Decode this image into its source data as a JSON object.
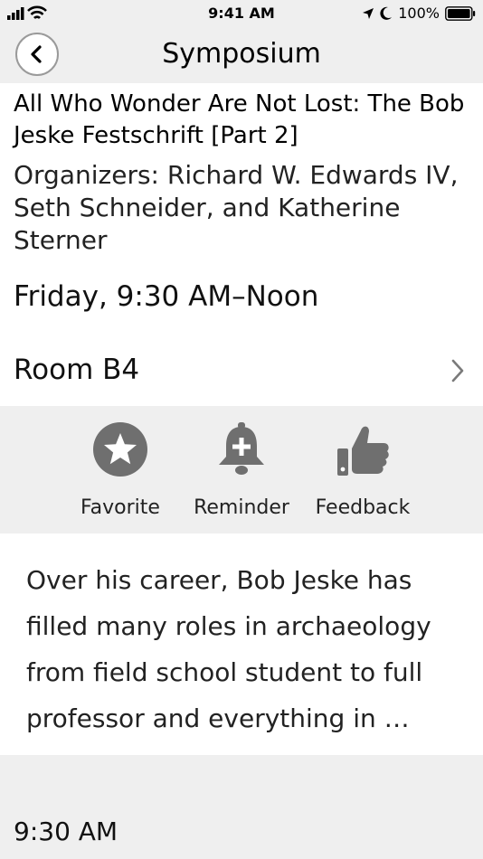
{
  "status_bar": {
    "time": "9:41 AM",
    "battery": "100%"
  },
  "nav": {
    "title": "Symposium",
    "back_icon": "chevron-left-icon"
  },
  "session": {
    "title": "All Who Wonder Are Not Lost: The Bob Jeske Festschrift [Part 2]",
    "organizers": "Organizers: Richard W. Edwards IV, Seth Schneider, and Katherine Sterner",
    "when": "Friday, 9:30 AM–Noon",
    "room": "Room B4"
  },
  "actions": [
    {
      "label": "Favorite",
      "icon": "star-icon"
    },
    {
      "label": "Reminder",
      "icon": "bell-plus-icon"
    },
    {
      "label": "Feedback",
      "icon": "thumbs-up-icon"
    }
  ],
  "description": "Over his career, Bob Jeske has filled many roles in archaeology from field school student to full professor and everything in …",
  "first_slot_time": "9:30 AM",
  "colors": {
    "background": "#efefef",
    "card": "#ffffff",
    "icon_gray": "#6f6f6f"
  }
}
